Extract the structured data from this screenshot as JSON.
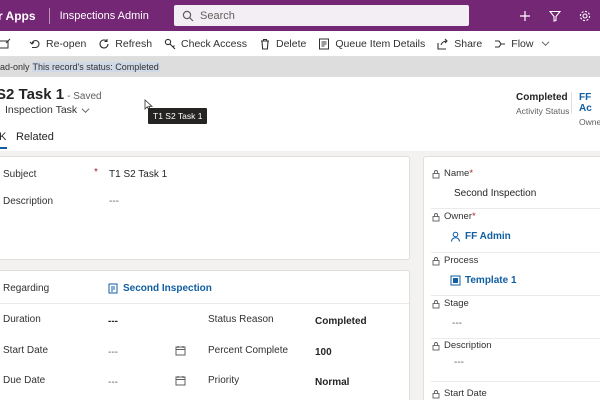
{
  "topbar": {
    "app_name": "r Apps",
    "area_name": "Inspections Admin",
    "search_placeholder": "Search"
  },
  "commands": [
    {
      "label": "Re-open",
      "icon": "reopen-icon"
    },
    {
      "label": "Refresh",
      "icon": "refresh-icon"
    },
    {
      "label": "Check Access",
      "icon": "key-icon"
    },
    {
      "label": "Delete",
      "icon": "trash-icon"
    },
    {
      "label": "Queue Item Details",
      "icon": "queue-icon"
    },
    {
      "label": "Share",
      "icon": "share-icon"
    },
    {
      "label": "Flow",
      "icon": "flow-icon"
    }
  ],
  "notice": {
    "prefix": "ad-only",
    "message": "This record's status: Completed"
  },
  "record": {
    "title": "S2 Task 1",
    "saved": "- Saved",
    "entity_type": "Inspection Task",
    "status_value": "Completed",
    "status_label": "Activity Status",
    "owner_value": "FF Ac",
    "owner_label": "Owner"
  },
  "tooltip": "T1 S2 Task 1",
  "tabs": {
    "general_fragment": "K",
    "related": "Related"
  },
  "general": {
    "subject_label": "Subject",
    "subject_value": "T1 S2 Task 1",
    "description_label": "Description",
    "description_value": "---"
  },
  "details": {
    "regarding_label": "Regarding",
    "regarding_value": "Second Inspection",
    "duration_label": "Duration",
    "duration_value": "---",
    "status_reason_label": "Status Reason",
    "status_reason_value": "Completed",
    "start_date_label": "Start Date",
    "start_date_value": "---",
    "percent_label": "Percent Complete",
    "percent_value": "100",
    "due_date_label": "Due Date",
    "due_date_value": "---",
    "priority_label": "Priority",
    "priority_value": "Normal"
  },
  "side": {
    "name_label": "Name",
    "name_value": "Second Inspection",
    "owner_label": "Owner",
    "owner_value": "FF Admin",
    "process_label": "Process",
    "process_value": "Template 1",
    "stage_label": "Stage",
    "stage_value": "---",
    "description_label": "Description",
    "description_value": "---",
    "start_date_label": "Start Date"
  },
  "colors": {
    "brand": "#742774",
    "link": "#115ea3"
  }
}
